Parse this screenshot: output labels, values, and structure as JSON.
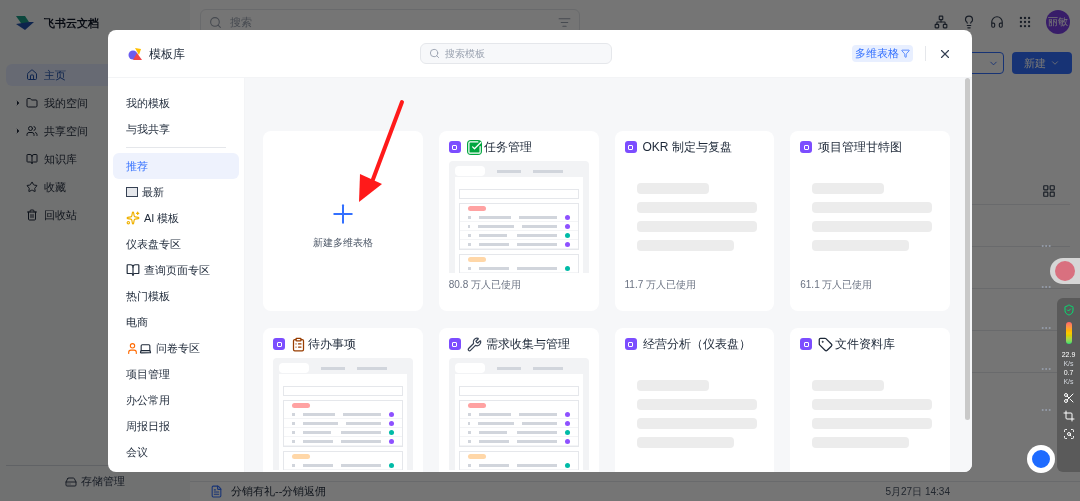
{
  "app": {
    "name": "飞书云文档",
    "search_placeholder": "搜索",
    "avatar": "丽敏",
    "new_button": "新建"
  },
  "sidebar": {
    "items": [
      {
        "label": "主页",
        "selected": true,
        "expandable": false,
        "kind": "home"
      },
      {
        "label": "我的空间",
        "selected": false,
        "expandable": true,
        "kind": "folder"
      },
      {
        "label": "共享空间",
        "selected": false,
        "expandable": true,
        "kind": "users"
      },
      {
        "label": "知识库",
        "selected": false,
        "expandable": false,
        "kind": "book"
      },
      {
        "label": "收藏",
        "selected": false,
        "expandable": false,
        "kind": "star"
      },
      {
        "label": "回收站",
        "selected": false,
        "expandable": false,
        "kind": "trash"
      }
    ],
    "footer": "存储管理"
  },
  "doc_rows": [
    {
      "title": "分销有礼--分销返佣",
      "time": "5月27日 14:34"
    }
  ],
  "speed_widget": {
    "upload": "22.9",
    "upload_unit": "K/s",
    "download": "0.7",
    "download_unit": "K/s"
  },
  "modal": {
    "title": "模板库",
    "search_placeholder": "搜索模板",
    "filter": "多维表格",
    "categories": [
      {
        "label": "我的模板",
        "selected": false,
        "kind": "plain"
      },
      {
        "label": "与我共享",
        "selected": false,
        "kind": "plain"
      },
      {
        "kind": "divider"
      },
      {
        "label": "推荐",
        "selected": true,
        "kind": "plain"
      },
      {
        "label": "最新",
        "selected": false,
        "kind": "new"
      },
      {
        "label": "AI 模板",
        "selected": false,
        "kind": "ai"
      },
      {
        "label": "仪表盘专区",
        "selected": false,
        "kind": "plain"
      },
      {
        "label": "查询页面专区",
        "selected": false,
        "kind": "book"
      },
      {
        "label": "热门模板",
        "selected": false,
        "kind": "plain"
      },
      {
        "label": "电商",
        "selected": false,
        "kind": "plain"
      },
      {
        "label": "问卷专区",
        "selected": false,
        "kind": "survey"
      },
      {
        "label": "项目管理",
        "selected": false,
        "kind": "plain"
      },
      {
        "label": "办公常用",
        "selected": false,
        "kind": "plain"
      },
      {
        "label": "周报日报",
        "selected": false,
        "kind": "plain"
      },
      {
        "label": "会议",
        "selected": false,
        "kind": "plain"
      }
    ],
    "cards": [
      {
        "kind": "create",
        "label": "新建多维表格"
      },
      {
        "kind": "template",
        "title": "任务管理",
        "title_icon": {
          "kind": "check"
        },
        "preview": {
          "kind": "table"
        },
        "usage": "80.8 万人已使用"
      },
      {
        "kind": "template",
        "title": "OKR 制定与复盘",
        "preview": {
          "kind": "loading"
        },
        "usage": "11.7 万人已使用"
      },
      {
        "kind": "template",
        "title": "项目管理甘特图",
        "preview": {
          "kind": "loading"
        },
        "usage": "61.1 万人已使用"
      },
      {
        "kind": "template",
        "title": "待办事项",
        "title_icon": {
          "kind": "clipboard"
        },
        "preview": {
          "kind": "table"
        }
      },
      {
        "kind": "template",
        "title": "需求收集与管理",
        "title_icon": {
          "kind": "tools"
        },
        "preview": {
          "kind": "table"
        }
      },
      {
        "kind": "template",
        "title": "经营分析（仪表盘）",
        "preview": {
          "kind": "loading"
        }
      },
      {
        "kind": "template",
        "title": "文件资料库",
        "title_icon": {
          "kind": "tag"
        },
        "preview": {
          "kind": "loading"
        }
      }
    ]
  }
}
